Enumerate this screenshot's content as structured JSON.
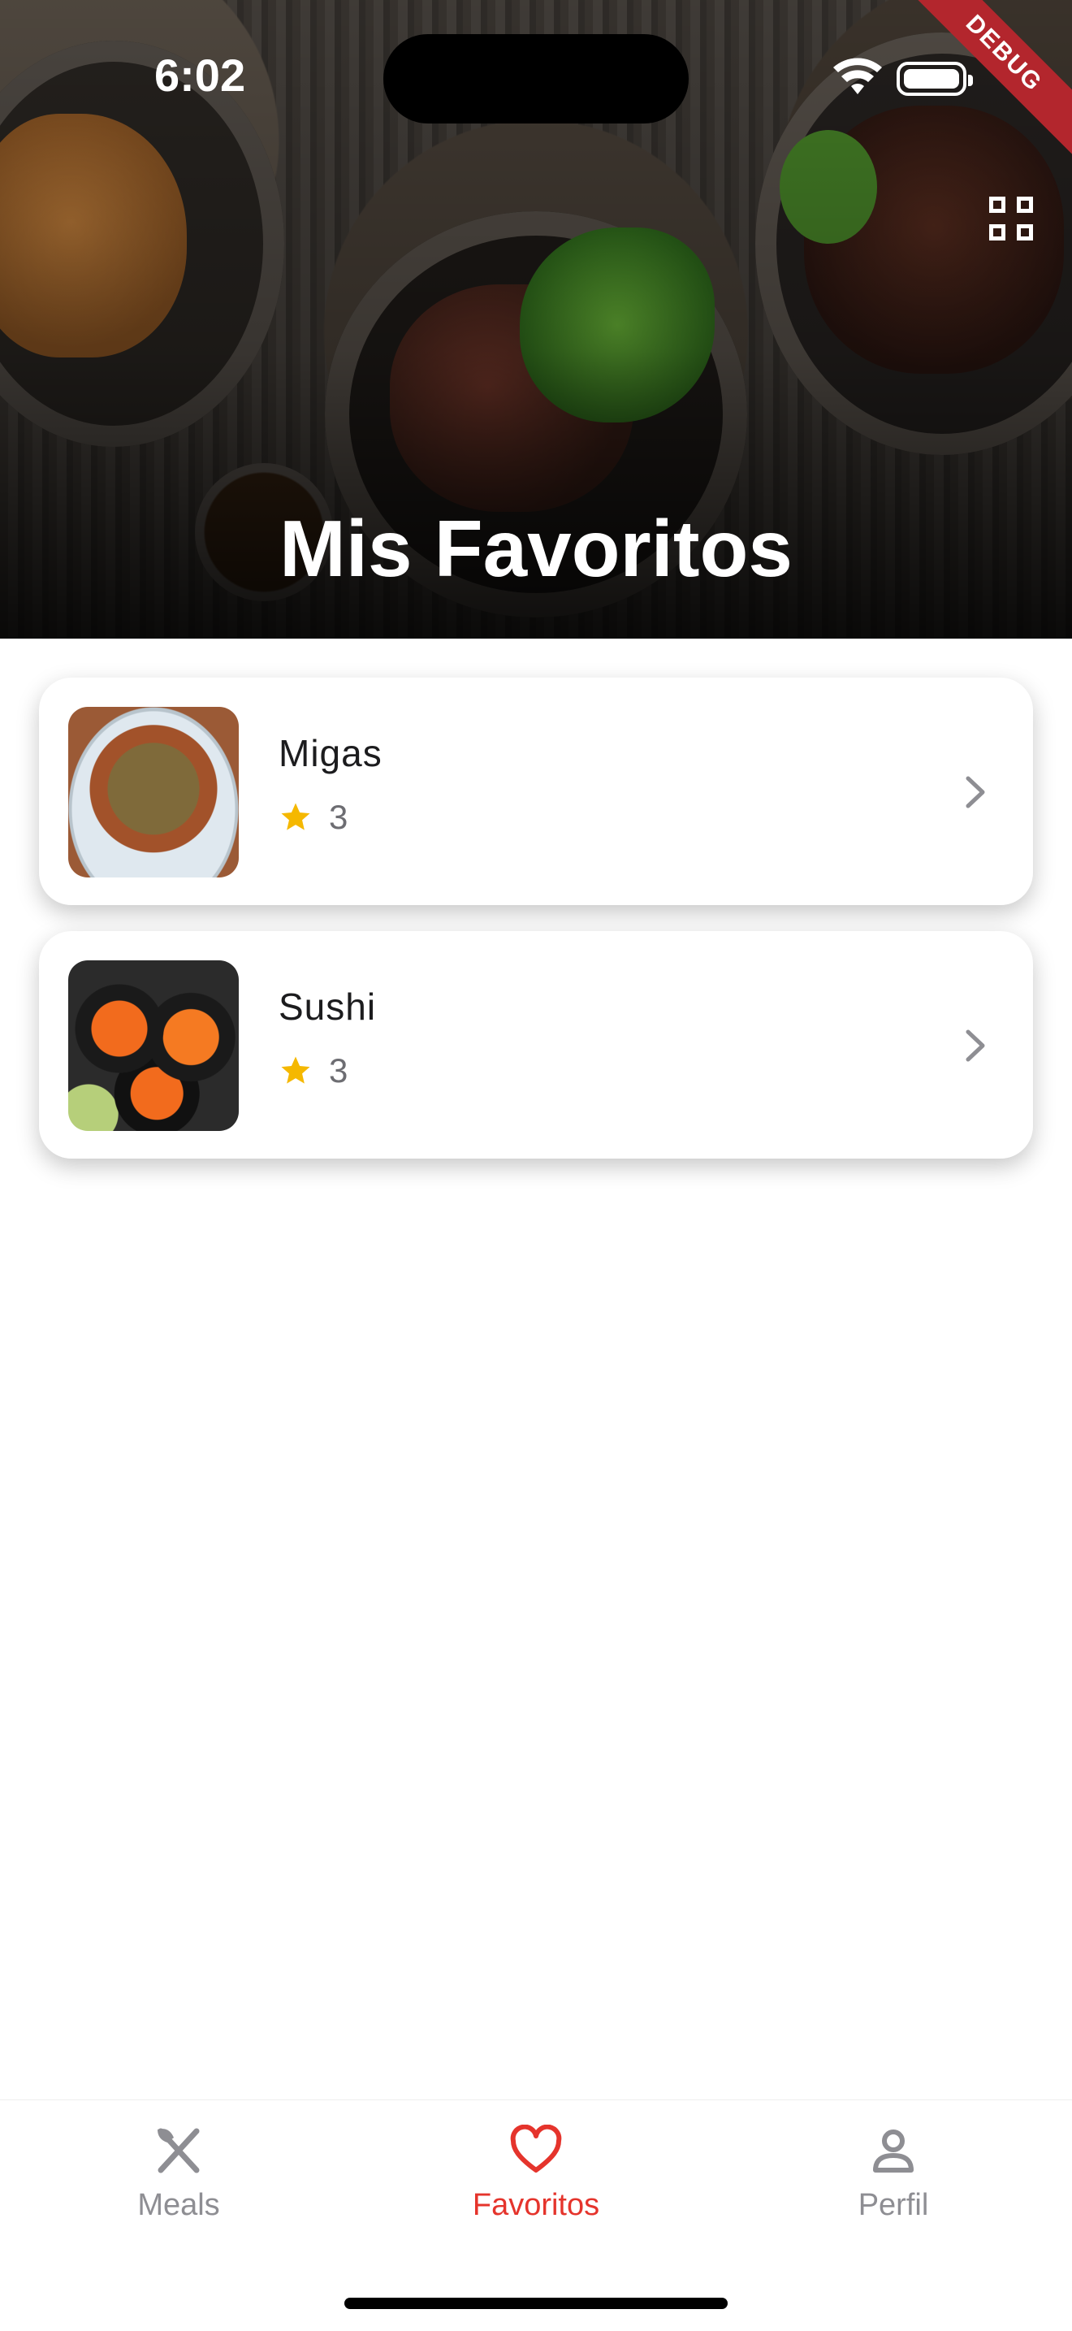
{
  "status_bar": {
    "time": "6:02",
    "debug_label": "DEBUG"
  },
  "header": {
    "title": "Mis Favoritos",
    "grid_icon": "grid-view-icon"
  },
  "favorites": [
    {
      "name": "Migas",
      "rating": "3",
      "thumb": "migas-photo"
    },
    {
      "name": "Sushi",
      "rating": "3",
      "thumb": "sushi-photo"
    }
  ],
  "tabs": [
    {
      "label": "Meals",
      "icon": "fork-knife-icon",
      "active": false
    },
    {
      "label": "Favoritos",
      "icon": "heart-icon",
      "active": true
    },
    {
      "label": "Perfil",
      "icon": "person-icon",
      "active": false
    }
  ],
  "colors": {
    "accent": "#e5342c",
    "inactive": "#8e8e93",
    "star": "#f5b800",
    "debug": "#b3262d"
  }
}
